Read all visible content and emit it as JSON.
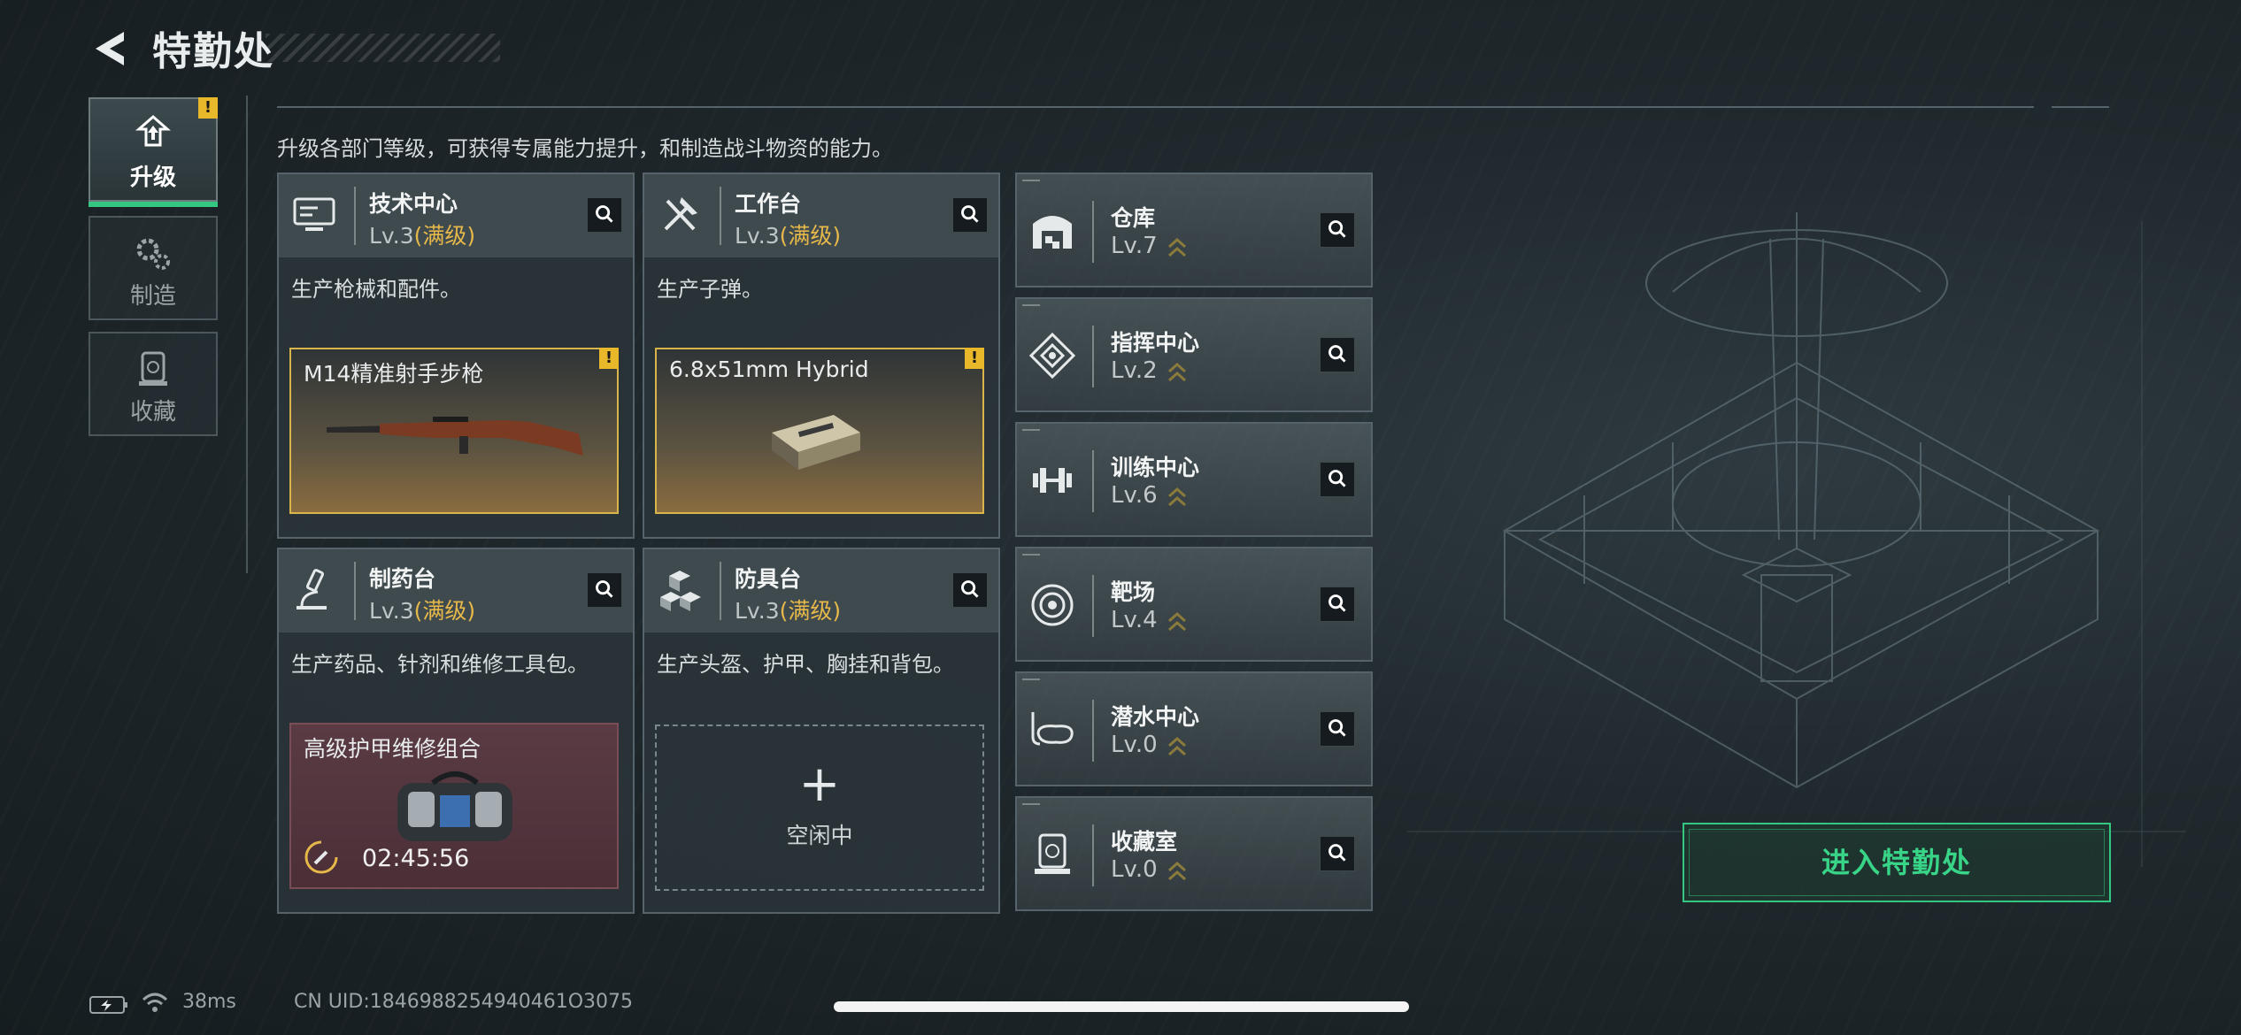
{
  "header": {
    "title": "特勤处"
  },
  "sidebar": {
    "tabs": [
      {
        "label": "升级",
        "active": true,
        "alert": "!"
      },
      {
        "label": "制造",
        "active": false
      },
      {
        "label": "收藏",
        "active": false
      }
    ]
  },
  "description": "升级各部门等级，可获得专属能力提升，和制造战斗物资的能力。",
  "departments": [
    {
      "name": "技术中心",
      "level": "Lv.3",
      "max": "(满级)",
      "function": "生产枪械和配件。",
      "production": {
        "name": "M14精准射手步枪",
        "alert": "!"
      },
      "icon": "monitor-icon"
    },
    {
      "name": "工作台",
      "level": "Lv.3",
      "max": "(满级)",
      "function": "生产子弹。",
      "production": {
        "name": "6.8x51mm Hybrid",
        "alert": "!"
      },
      "icon": "tools-icon"
    },
    {
      "name": "制药台",
      "level": "Lv.3",
      "max": "(满级)",
      "function": "生产药品、针剂和维修工具包。",
      "production": {
        "name": "高级护甲维修组合",
        "timer": "02:45:56"
      },
      "icon": "microscope-icon"
    },
    {
      "name": "防具台",
      "level": "Lv.3",
      "max": "(满级)",
      "function": "生产头盔、护甲、胸挂和背包。",
      "empty": {
        "plus": "+",
        "label": "空闲中"
      },
      "icon": "blocks-icon"
    }
  ],
  "facilities": [
    {
      "name": "仓库",
      "level": "Lv.7",
      "icon": "warehouse-icon"
    },
    {
      "name": "指挥中心",
      "level": "Lv.2",
      "icon": "command-icon"
    },
    {
      "name": "训练中心",
      "level": "Lv.6",
      "icon": "dumbbell-icon"
    },
    {
      "name": "靶场",
      "level": "Lv.4",
      "icon": "target-icon"
    },
    {
      "name": "潜水中心",
      "level": "Lv.0",
      "icon": "diving-mask-icon"
    },
    {
      "name": "收藏室",
      "level": "Lv.0",
      "icon": "collection-icon"
    }
  ],
  "enter_button": "进入特勤处",
  "status_bar": {
    "ping": "38ms",
    "uid": "CN UID:1846988254940461O3075"
  },
  "colors": {
    "accent_green": "#34c781",
    "max_gold": "#e6b84a",
    "alert_yellow": "#e8b82a"
  }
}
